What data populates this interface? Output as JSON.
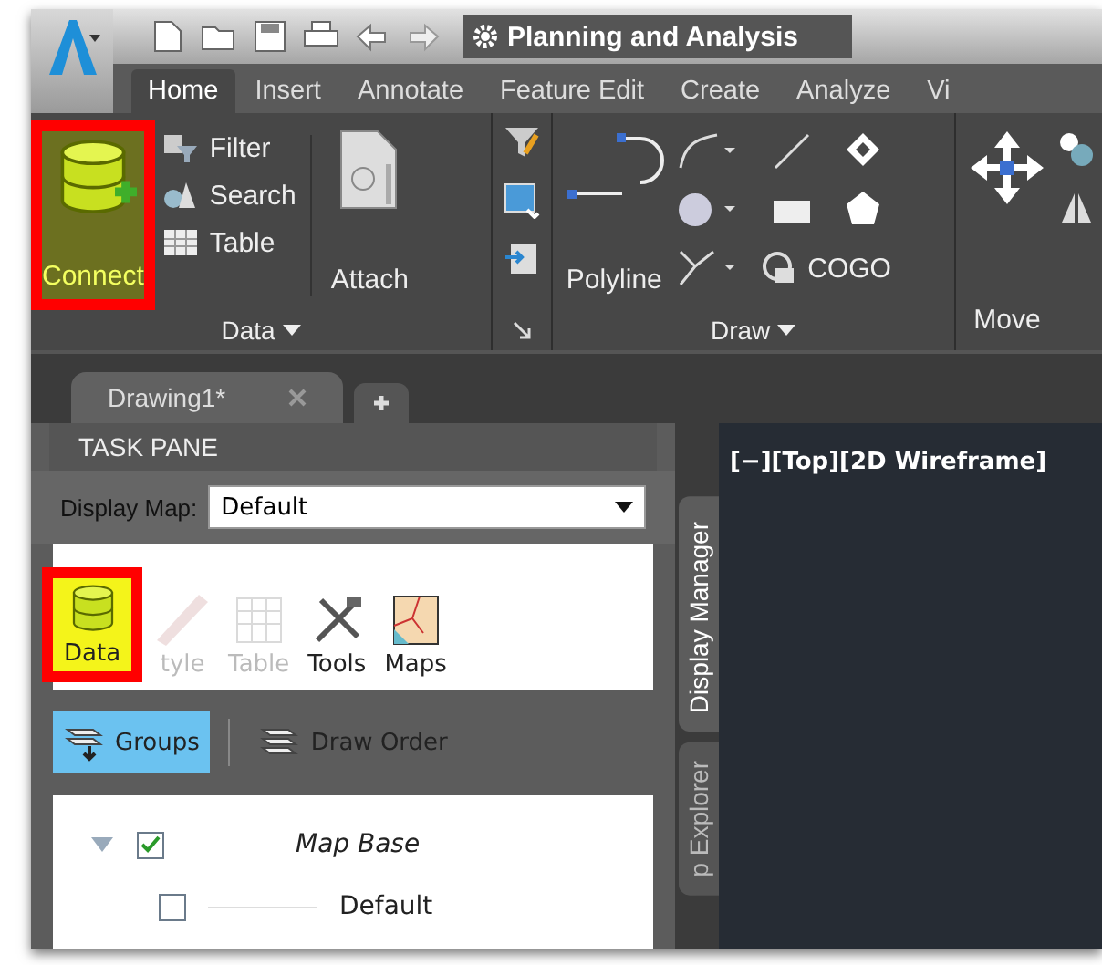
{
  "quick_access": {
    "workspace": "Planning and Analysis"
  },
  "ribbon_tabs": [
    {
      "label": "Home",
      "selected": true
    },
    {
      "label": "Insert",
      "selected": false
    },
    {
      "label": "Annotate",
      "selected": false
    },
    {
      "label": "Feature Edit",
      "selected": false
    },
    {
      "label": "Create",
      "selected": false
    },
    {
      "label": "Analyze",
      "selected": false
    },
    {
      "label": "Vi",
      "selected": false
    }
  ],
  "ribbon": {
    "data_panel": {
      "title": "Data",
      "connect": {
        "label": "Connect",
        "highlighted": true
      },
      "tools": [
        "Filter",
        "Search",
        "Table"
      ],
      "attach": "Attach"
    },
    "draw_panel": {
      "title": "Draw",
      "polyline": "Polyline",
      "cogo": "COGO"
    },
    "modify_panel": {
      "move": "Move"
    }
  },
  "document_tabs": [
    {
      "label": "Drawing1*",
      "selected": true
    }
  ],
  "task_pane": {
    "title": "TASK PANE",
    "display_map_label": "Display Map:",
    "display_map_value": "Default",
    "toolbar": [
      {
        "label": "Data",
        "disabled": false,
        "highlighted": true
      },
      {
        "label": "tyle",
        "disabled": true,
        "highlighted": false
      },
      {
        "label": "Table",
        "disabled": true,
        "highlighted": false
      },
      {
        "label": "Tools",
        "disabled": false,
        "highlighted": false
      },
      {
        "label": "Maps",
        "disabled": false,
        "highlighted": false
      }
    ],
    "view_buttons": [
      {
        "label": "Groups",
        "selected": true
      },
      {
        "label": "Draw Order",
        "selected": false
      }
    ],
    "tree": [
      {
        "label": "Map Base",
        "checked": true,
        "expanded": true,
        "children": [
          {
            "label": "Default",
            "checked": false
          }
        ]
      }
    ]
  },
  "side_tabs": [
    {
      "label": "Display Manager",
      "selected": true
    },
    {
      "label": "p Explorer",
      "selected": false
    }
  ],
  "viewport": {
    "label": "[−][Top][2D Wireframe]"
  }
}
